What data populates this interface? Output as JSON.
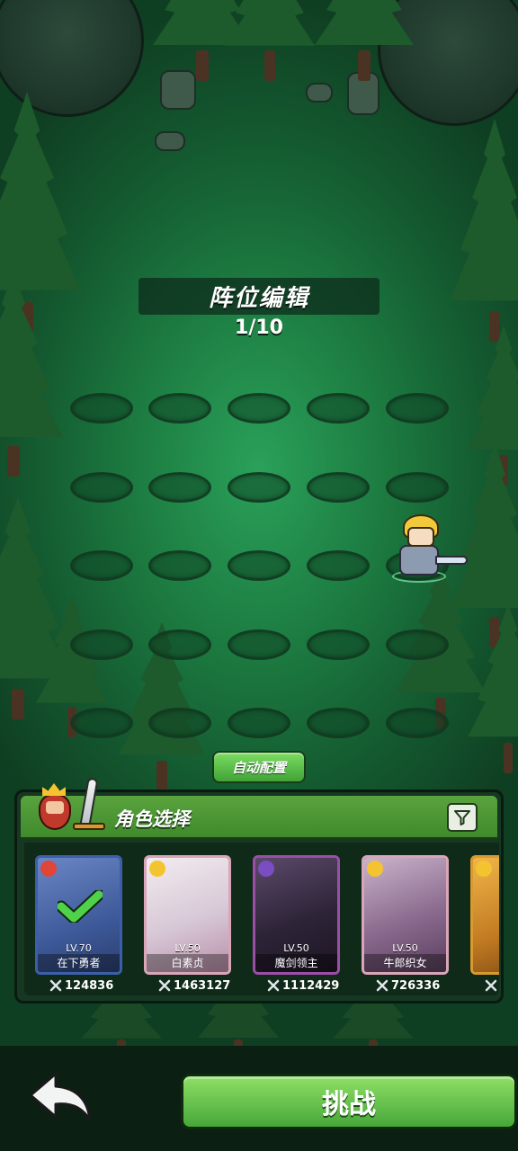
{
  "header": {
    "title": "阵位编辑",
    "slot_count": "1/10"
  },
  "auto_config_label": "自动配置",
  "panel": {
    "title": "角色选择",
    "filter_icon": "filter-icon"
  },
  "characters": [
    {
      "name": "在下勇者",
      "level": "LV.70",
      "power": "124836",
      "selected": true,
      "element_icon": "dumbbell-icon",
      "element_color": "#e0453a",
      "frame_color": "#3b5fa8"
    },
    {
      "name": "白素贞",
      "level": "LV.50",
      "power": "1463127",
      "selected": false,
      "element_icon": "sun-icon",
      "element_color": "#f4c430",
      "frame_color": "#d9a5b8"
    },
    {
      "name": "魔剑领主",
      "level": "LV.50",
      "power": "1112429",
      "selected": false,
      "element_icon": "moon-icon",
      "element_color": "#7b4cc2",
      "frame_color": "#9a4ea8"
    },
    {
      "name": "牛郎织女",
      "level": "LV.50",
      "power": "726336",
      "selected": false,
      "element_icon": "sun-icon",
      "element_color": "#f4c430",
      "frame_color": "#d9a5b8"
    },
    {
      "name": "",
      "level": "",
      "power": "",
      "selected": false,
      "element_icon": "sun-icon",
      "element_color": "#f4c430",
      "frame_color": "#d89a2e"
    }
  ],
  "bottom": {
    "back_icon": "back-arrow-icon",
    "challenge_label": "挑战"
  }
}
